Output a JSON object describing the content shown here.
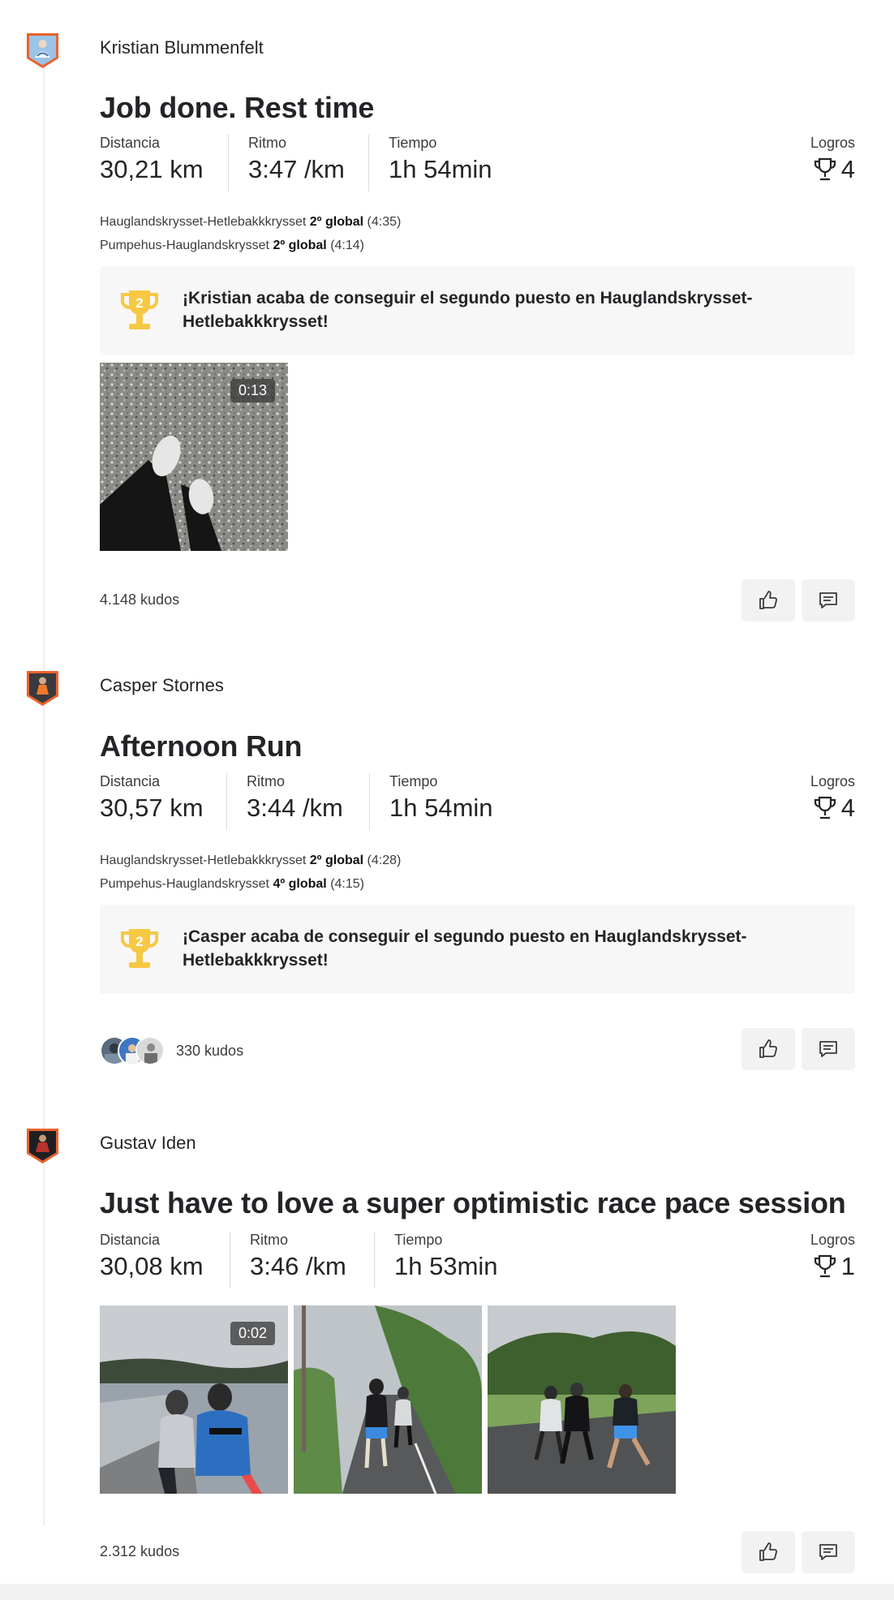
{
  "labels": {
    "distance": "Distancia",
    "pace": "Ritmo",
    "time": "Tiempo",
    "achievements": "Logros"
  },
  "colors": {
    "trophy_gold": "#f7c843",
    "avatar_border": "#e8622d",
    "button_bg": "#f2f2f2"
  },
  "icons": {
    "achievement": "trophy-icon",
    "kudo": "thumbs-up-icon",
    "comment": "comment-icon",
    "achievement_badge": "trophy-2nd-place-icon"
  },
  "posts": [
    {
      "athlete": "Kristian Blummenfelt",
      "title": "Job done. Rest time",
      "distance": "30,21 km",
      "pace": "3:47 /km",
      "time": "1h 54min",
      "achievements_count": "4",
      "segments": [
        {
          "name": "Hauglandskrysset-Hetlebakkkrysset",
          "rank": "2º global",
          "time": "(4:35)"
        },
        {
          "name": "Pumpehus-Hauglandskrysset",
          "rank": "2º global",
          "time": "(4:14)"
        }
      ],
      "achievement_text": "¡Kristian acaba de conseguir el segundo puesto en Hauglandskrysset-Hetlebakkkrysset!",
      "achievement_rank": "2",
      "media": [
        {
          "duration": "0:13"
        }
      ],
      "kudos": "4.148 kudos"
    },
    {
      "athlete": "Casper Stornes",
      "title": "Afternoon Run",
      "distance": "30,57 km",
      "pace": "3:44 /km",
      "time": "1h 54min",
      "achievements_count": "4",
      "segments": [
        {
          "name": "Hauglandskrysset-Hetlebakkkrysset",
          "rank": "2º global",
          "time": "(4:28)"
        },
        {
          "name": "Pumpehus-Hauglandskrysset",
          "rank": "4º global",
          "time": "(4:15)"
        }
      ],
      "achievement_text": "¡Casper acaba de conseguir el segundo puesto en Hauglandskrysset-Hetlebakkkrysset!",
      "achievement_rank": "2",
      "kudos": "330 kudos"
    },
    {
      "athlete": "Gustav Iden",
      "title": "Just have to love a super optimistic race pace session",
      "distance": "30,08 km",
      "pace": "3:46 /km",
      "time": "1h 53min",
      "achievements_count": "1",
      "media": [
        {
          "duration": "0:02"
        },
        {
          "duration": ""
        },
        {
          "duration": ""
        }
      ],
      "kudos": "2.312 kudos"
    }
  ]
}
